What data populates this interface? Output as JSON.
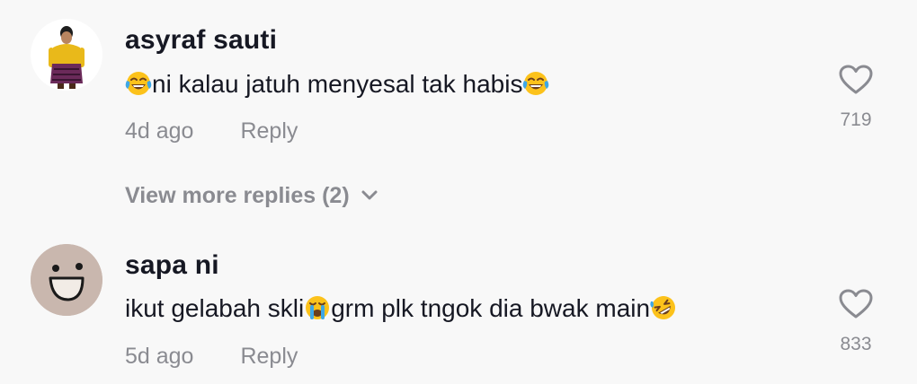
{
  "comments": [
    {
      "username": "asyraf sauti",
      "text_parts": [
        "ni kalau jatuh menyesal tak habis"
      ],
      "emojis": [
        "face-with-tears-of-joy",
        "face-with-tears-of-joy"
      ],
      "time": "4d ago",
      "reply_label": "Reply",
      "likes": "719",
      "avatar": "person-in-yellow-outfit"
    },
    {
      "username": "sapa ni",
      "text_parts": [
        "ikut gelabah skli",
        "grm plk tngok dia bwak main"
      ],
      "emojis": [
        "loudly-crying-face",
        "rolling-on-the-floor-laughing"
      ],
      "time": "5d ago",
      "reply_label": "Reply",
      "likes": "833",
      "avatar": "smiley-face-drawing"
    }
  ],
  "view_more": {
    "label": "View more replies (2)"
  },
  "colors": {
    "background": "#f8f8f8",
    "primary_text": "#161823",
    "secondary_text": "#8a8b91",
    "emoji_yellow": "#fcc21b"
  }
}
